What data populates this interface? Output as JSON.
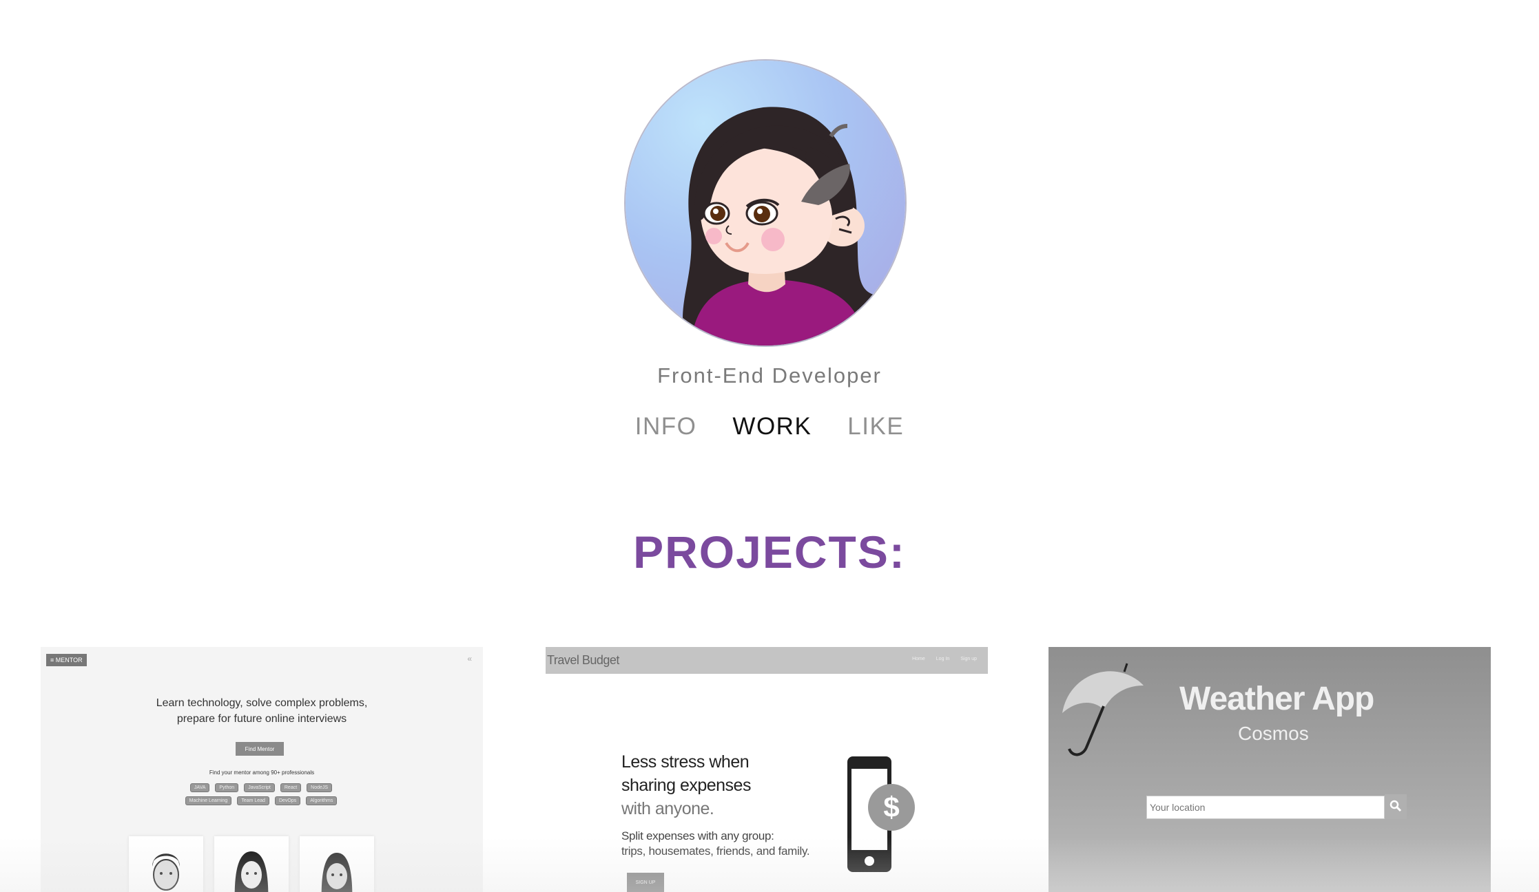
{
  "profile": {
    "avatar_alt": "avatar",
    "role": "Front-End Developer"
  },
  "nav": {
    "items": [
      {
        "label": "INFO",
        "active": false
      },
      {
        "label": "WORK",
        "active": true
      },
      {
        "label": "LIKE",
        "active": false
      }
    ]
  },
  "projects": {
    "title": "PROJECTS:",
    "title_color": "#7b4a9e",
    "cards": [
      {
        "logo": "≡ MENTOR",
        "collapse": "«",
        "headline_line1": "Learn technology, solve complex problems,",
        "headline_line2": "prepare for future online interviews",
        "cta": "Find Mentor",
        "sub": "Find your mentor among 90+ professionals",
        "tags": [
          "JAVA",
          "Python",
          "JavaScript",
          "React",
          "NodeJS",
          "Machine Learning",
          "Team Lead",
          "DevOps",
          "Algorithms"
        ]
      },
      {
        "brand": "Travel Budget",
        "links": [
          "Home",
          "Log In",
          "Sign up"
        ],
        "headline_line1": "Less stress when",
        "headline_line2": "sharing expenses",
        "headline_line3": "with anyone.",
        "body_line1": "Split expenses with any group:",
        "body_line2": "trips, housemates, friends, and family.",
        "signup": "SIGN UP",
        "phone_symbol": "$"
      },
      {
        "title": "Weather App",
        "subtitle": "Cosmos",
        "input_placeholder": "Your location",
        "search_icon": "magnifier-icon"
      }
    ]
  }
}
